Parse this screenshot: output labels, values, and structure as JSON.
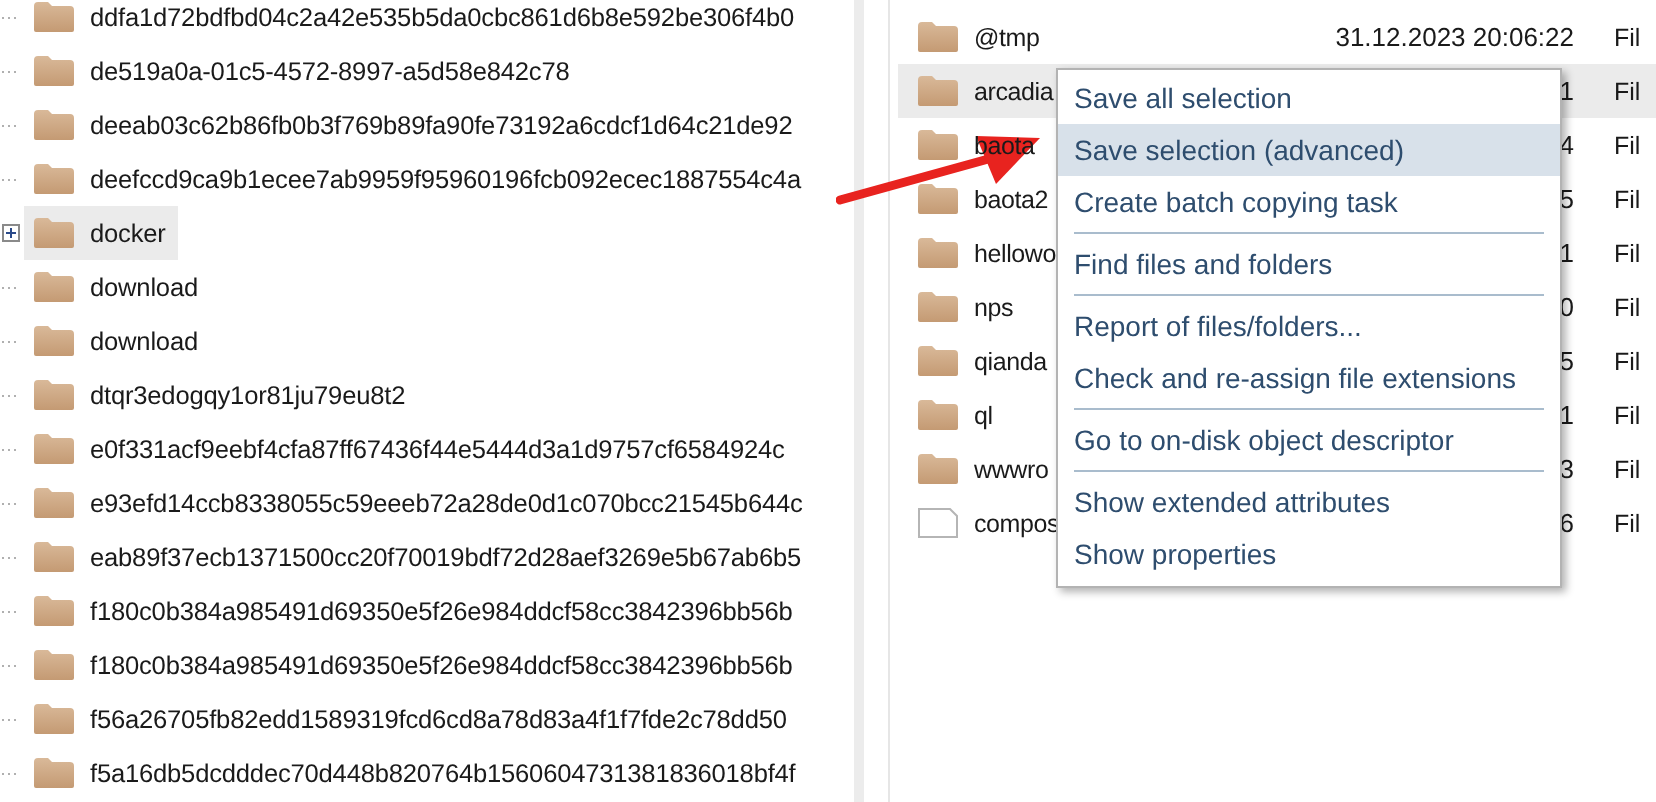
{
  "tree": {
    "items": [
      {
        "name": "ddfa1d72bdfbd04c2a42e535b5da0cbc861d6b8e592be306f4b0",
        "has_children": false,
        "selected": false
      },
      {
        "name": "de519a0a-01c5-4572-8997-a5d58e842c78",
        "has_children": false,
        "selected": false
      },
      {
        "name": "deeab03c62b86fb0b3f769b89fa90fe73192a6cdcf1d64c21de92",
        "has_children": false,
        "selected": false
      },
      {
        "name": "deefccd9ca9b1ecee7ab9959f95960196fcb092ecec1887554c4a",
        "has_children": false,
        "selected": false
      },
      {
        "name": "docker",
        "has_children": true,
        "selected": true
      },
      {
        "name": "download",
        "has_children": false,
        "selected": false
      },
      {
        "name": "download",
        "has_children": false,
        "selected": false
      },
      {
        "name": "dtqr3edogqy1or81ju79eu8t2",
        "has_children": false,
        "selected": false
      },
      {
        "name": "e0f331acf9eebf4cfa87ff67436f44e5444d3a1d9757cf6584924c",
        "has_children": false,
        "selected": false
      },
      {
        "name": "e93efd14ccb8338055c59eeeb72a28de0d1c070bcc21545b644c",
        "has_children": false,
        "selected": false
      },
      {
        "name": "eab89f37ecb1371500cc20f70019bdf72d28aef3269e5b67ab6b5",
        "has_children": false,
        "selected": false
      },
      {
        "name": "f180c0b384a985491d69350e5f26e984ddcf58cc3842396bb56b",
        "has_children": false,
        "selected": false
      },
      {
        "name": "f180c0b384a985491d69350e5f26e984ddcf58cc3842396bb56b",
        "has_children": false,
        "selected": false
      },
      {
        "name": "f56a26705fb82edd1589319fcd6cd8a78d83a4f1f7fde2c78dd50",
        "has_children": false,
        "selected": false
      },
      {
        "name": "f5a16db5dcdddec70d448b820764b1560604731381836018bf4f",
        "has_children": false,
        "selected": false
      }
    ]
  },
  "file_list": {
    "rows": [
      {
        "kind": "folder",
        "name": "@tmp",
        "modified": "31.12.2023 20:06:22",
        "type": "Fil",
        "selected": false
      },
      {
        "kind": "folder",
        "name": "arcadia",
        "modified": "1",
        "type": "Fil",
        "selected": true
      },
      {
        "kind": "folder",
        "name": "baota",
        "modified": "4",
        "type": "Fil",
        "selected": false
      },
      {
        "kind": "folder",
        "name": "baota2",
        "modified": "5",
        "type": "Fil",
        "selected": false
      },
      {
        "kind": "folder",
        "name": "hellowo",
        "modified": "1",
        "type": "Fil",
        "selected": false
      },
      {
        "kind": "folder",
        "name": "nps",
        "modified": "0",
        "type": "Fil",
        "selected": false
      },
      {
        "kind": "folder",
        "name": "qianda",
        "modified": "5",
        "type": "Fil",
        "selected": false
      },
      {
        "kind": "folder",
        "name": "ql",
        "modified": "1",
        "type": "Fil",
        "selected": false
      },
      {
        "kind": "folder",
        "name": "wwwro",
        "modified": "3",
        "type": "Fil",
        "selected": false
      },
      {
        "kind": "file",
        "name": "compos",
        "modified": "6",
        "type": "Fil",
        "selected": false
      }
    ]
  },
  "context_menu": {
    "items": [
      {
        "label": "Save all selection",
        "selected": false,
        "separator_after": false
      },
      {
        "label": "Save selection (advanced)",
        "selected": true,
        "separator_after": false
      },
      {
        "label": "Create batch copying task",
        "selected": false,
        "separator_after": true
      },
      {
        "label": "Find files and folders",
        "selected": false,
        "separator_after": true
      },
      {
        "label": "Report of files/folders...",
        "selected": false,
        "separator_after": false
      },
      {
        "label": "Check and re-assign file extensions",
        "selected": false,
        "separator_after": true
      },
      {
        "label": "Go to on-disk object descriptor",
        "selected": false,
        "separator_after": true
      },
      {
        "label": "Show extended attributes",
        "selected": false,
        "separator_after": false
      },
      {
        "label": "Show properties",
        "selected": false,
        "separator_after": false
      }
    ]
  }
}
